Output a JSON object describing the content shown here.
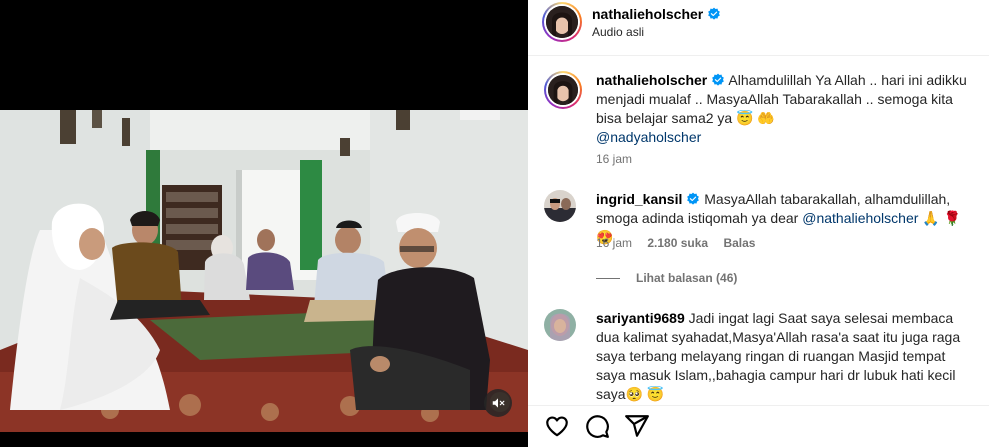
{
  "post": {
    "username": "nathalieholscher",
    "audio_label": "Audio asli"
  },
  "caption": {
    "username": "nathalieholscher",
    "text": "Alhamdulillah Ya Allah .. hari ini adikku menjadi mualaf .. MasyaAllah Tabarakallah .. semoga kita bisa belajar sama2 ya 😇 🤲",
    "mention": "@nadyaholscher",
    "time": "16 jam"
  },
  "comments": [
    {
      "username": "ingrid_kansil",
      "verified": true,
      "text": "MasyaAllah tabarakallah, alhamdulillah, smoga adinda istiqomah ya dear",
      "mention": "@nathalieholscher",
      "emojis": "🙏 🌹 😍",
      "time": "16 jam",
      "likes": "2.180 suka",
      "reply_label": "Balas",
      "view_replies": "Lihat balasan (46)"
    },
    {
      "username": "sariyanti9689",
      "verified": false,
      "text": "Jadi ingat lagi Saat saya selesai membaca dua kalimat syahadat,Masya'Allah rasa'a saat itu juga raga saya terbang melayang ringan di ruangan Masjid tempat saya masuk Islam,,bahagia campur hari dr lubuk hati kecil saya🥺 😇"
    }
  ],
  "icons": {
    "verified": "verified-badge-icon",
    "mute": "muted-speaker-icon",
    "like": "heart-icon",
    "comment": "comment-bubble-icon",
    "share": "paper-plane-icon"
  },
  "colors": {
    "verified": "#0095f6",
    "mention": "#00376b",
    "secondary_text": "#737373"
  }
}
